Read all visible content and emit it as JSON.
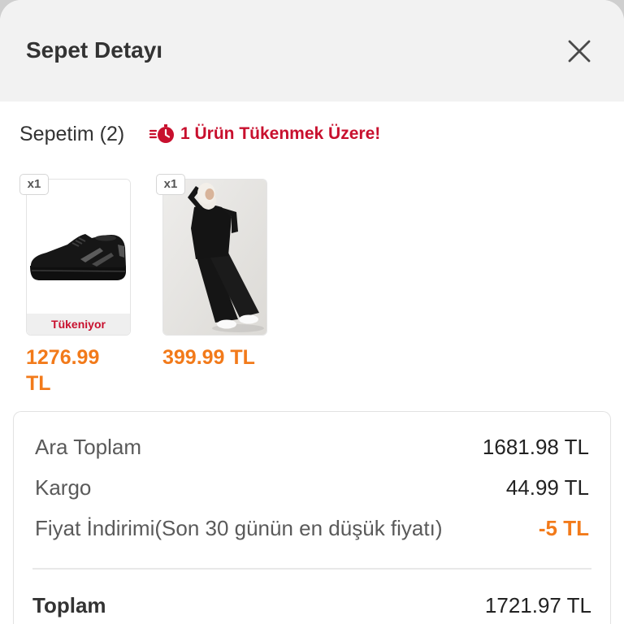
{
  "header": {
    "title": "Sepet Detayı",
    "close_icon": "close-icon"
  },
  "cart": {
    "title": "Sepetim (2)",
    "warning": {
      "icon": "stopwatch-icon",
      "text": "1 Ürün Tükenmek Üzere!"
    },
    "items": [
      {
        "quantity": "x1",
        "status": "Tükeniyor",
        "price": "1276.99 TL"
      },
      {
        "quantity": "x1",
        "price": "399.99 TL"
      }
    ]
  },
  "summary": {
    "rows": [
      {
        "label": "Ara Toplam",
        "value": "1681.98 TL"
      },
      {
        "label": "Kargo",
        "value": "44.99 TL"
      },
      {
        "label": "Fiyat İndirimi(Son 30 günün en düşük fiyatı)",
        "value": "-5 TL"
      }
    ],
    "total": {
      "label": "Toplam",
      "value": "1721.97 TL"
    }
  },
  "colors": {
    "accent": "#f27a1a",
    "warning": "#c8102e",
    "header_bg": "#f2f2f2"
  }
}
